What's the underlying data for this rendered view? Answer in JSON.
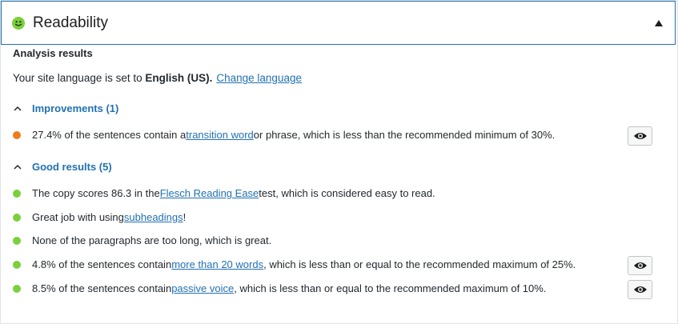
{
  "colors": {
    "good": "#7ad03a",
    "ok": "#ee7c1b",
    "link": "#2271b1",
    "smiley": "#7ad03a"
  },
  "header": {
    "title": "Readability",
    "icon": "smiley-face-icon",
    "toggle_icon": "triangle-up-icon"
  },
  "analysis": {
    "heading": "Analysis results",
    "language": {
      "prefix": "Your site language is set to ",
      "value": "English (US).",
      "link": "Change language"
    }
  },
  "improvements": {
    "title": "Improvements (1)",
    "items": [
      {
        "status": "ok",
        "before": "27.4% of the sentences contain a ",
        "link": "transition word",
        "after": " or phrase, which is less than the recommended minimum of 30%.",
        "has_eye": true
      }
    ]
  },
  "good_results": {
    "title": "Good results (5)",
    "items": [
      {
        "status": "good",
        "before": "The copy scores 86.3 in the ",
        "link": "Flesch Reading Ease",
        "after": " test, which is considered easy to read.",
        "has_eye": false
      },
      {
        "status": "good",
        "before": "Great job with using ",
        "link": "subheadings",
        "after": "!",
        "has_eye": false
      },
      {
        "status": "good",
        "before": "None of the paragraphs are too long, which is great.",
        "link": "",
        "after": "",
        "has_eye": false
      },
      {
        "status": "good",
        "before": "4.8% of the sentences contain ",
        "link": "more than 20 words",
        "after": ", which is less than or equal to the recommended maximum of 25%.",
        "has_eye": true
      },
      {
        "status": "good",
        "before": "8.5% of the sentences contain ",
        "link": "passive voice",
        "after": ", which is less than or equal to the recommended maximum of 10%.",
        "has_eye": true
      }
    ]
  }
}
